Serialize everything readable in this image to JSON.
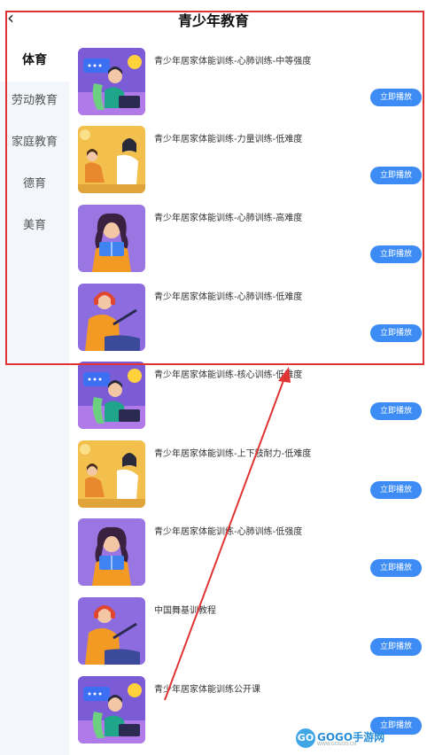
{
  "header": {
    "title": "青少年教育",
    "back_icon": "chevron-left-icon"
  },
  "sidebar": {
    "items": [
      {
        "label": "体育",
        "active": true
      },
      {
        "label": "劳动教育",
        "active": false
      },
      {
        "label": "家庭教育",
        "active": false
      },
      {
        "label": "德育",
        "active": false
      },
      {
        "label": "美育",
        "active": false
      }
    ]
  },
  "courses": [
    {
      "title": "青少年居家体能训练-心肺训练-中等强度",
      "button": "立即播放",
      "thumb": "laptop-person-illustration"
    },
    {
      "title": "青少年居家体能训练-力量训练-低难度",
      "button": "立即播放",
      "thumb": "friends-chatting-illustration"
    },
    {
      "title": "青少年居家体能训练-心肺训练-高难度",
      "button": "立即播放",
      "thumb": "reading-girl-illustration"
    },
    {
      "title": "青少年居家体能训练-心肺训练-低难度",
      "button": "立即播放",
      "thumb": "headphone-painter-illustration"
    },
    {
      "title": "青少年居家体能训练-核心训练-低难度",
      "button": "立即播放",
      "thumb": "laptop-person-illustration"
    },
    {
      "title": "青少年居家体能训练-上下肢耐力-低难度",
      "button": "立即播放",
      "thumb": "friends-chatting-illustration"
    },
    {
      "title": "青少年居家体能训练-心肺训练-低强度",
      "button": "立即播放",
      "thumb": "reading-girl-illustration"
    },
    {
      "title": "中国舞基训教程",
      "button": "立即播放",
      "thumb": "headphone-painter-illustration"
    },
    {
      "title": "青少年居家体能训练公开课",
      "button": "立即播放",
      "thumb": "laptop-person-illustration"
    }
  ],
  "colors": {
    "accent": "#3d8cf5",
    "annotation": "#e03434",
    "sidebar_bg": "#f3f6fa"
  },
  "watermark": {
    "logo": "GO",
    "text": "GOGO手游网",
    "sub": "WWW.GOGOO.CN"
  }
}
